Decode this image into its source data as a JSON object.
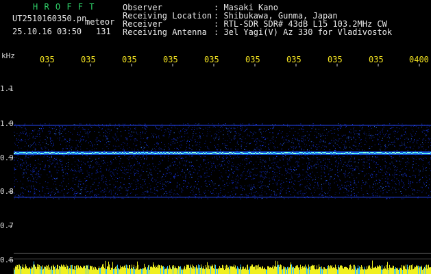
{
  "header": {
    "app_title": "H R O F F T",
    "file_label": "UT2510160350.pn",
    "file_suffix": "meteor",
    "timestamp": "25.10.16 03:50",
    "count": "131",
    "info_rows": [
      {
        "label": "Observer",
        "value": ": Masaki Kano"
      },
      {
        "label": "Receiving Location",
        "value": ": Shibukawa, Gunma, Japan"
      },
      {
        "label": "Receiver",
        "value": ": RTL-SDR SDR# 43dB L15 103.2MHz CW"
      },
      {
        "label": "Receiving Antenna",
        "value": ": 3el Yagi(V) Az 330 for Vladivostok"
      }
    ]
  },
  "time_axis": {
    "labels": [
      "035",
      "035",
      "035",
      "035",
      "035",
      "035",
      "035",
      "035",
      "035",
      "0400"
    ]
  },
  "freq_axis": {
    "unit": "kHz",
    "labels": [
      "1.1",
      "1.0",
      "0.9",
      "0.8",
      "0.7",
      "0.6"
    ]
  },
  "colors": {
    "title": "#2fd36a",
    "time_labels": "#f0e020",
    "noise": "#1a3cff",
    "signal": "#40e0ff",
    "baseline": "#f0f020"
  }
}
